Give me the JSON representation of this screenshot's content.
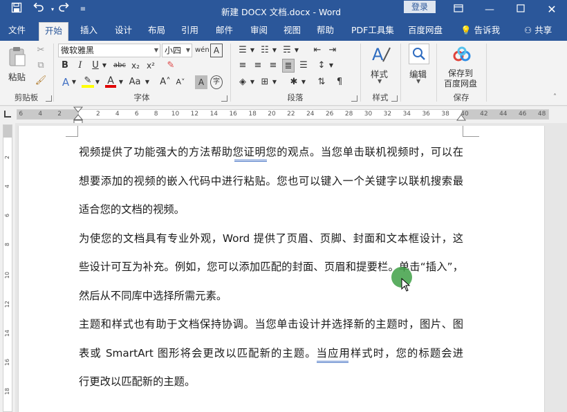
{
  "titlebar": {
    "title": "新建 DOCX 文档.docx  -  Word",
    "sign_in": "登录",
    "qat": {
      "save_icon": "save-icon",
      "undo_icon": "undo-icon",
      "redo_icon": "redo-icon",
      "customize_icon": "customize-qat-icon"
    }
  },
  "tabs": [
    {
      "label": "文件"
    },
    {
      "label": "开始"
    },
    {
      "label": "插入"
    },
    {
      "label": "设计"
    },
    {
      "label": "布局"
    },
    {
      "label": "引用"
    },
    {
      "label": "邮件"
    },
    {
      "label": "审阅"
    },
    {
      "label": "视图"
    },
    {
      "label": "帮助"
    },
    {
      "label": "PDF工具集"
    },
    {
      "label": "百度网盘"
    },
    {
      "label": "告诉我"
    },
    {
      "label": "共享"
    }
  ],
  "active_tab": "开始",
  "ribbon": {
    "clipboard": {
      "label": "剪贴板",
      "paste": "粘贴"
    },
    "font": {
      "label": "字体",
      "font_name": "微软雅黑",
      "font_size": "小四"
    },
    "paragraph": {
      "label": "段落"
    },
    "styles": {
      "label": "样式",
      "button": "样式"
    },
    "editing": {
      "button": "编辑"
    },
    "save": {
      "label": "保存",
      "button_line1": "保存到",
      "button_line2": "百度网盘"
    }
  },
  "ruler": {
    "ticks": [
      "6",
      "4",
      "2",
      "2",
      "4",
      "6",
      "8",
      "10",
      "12",
      "14",
      "16",
      "18",
      "20",
      "22",
      "24",
      "26",
      "28",
      "30",
      "32",
      "34",
      "36",
      "38",
      "40",
      "42",
      "44",
      "46",
      "48"
    ],
    "vticks": [
      "2",
      "4",
      "6",
      "8",
      "10",
      "12",
      "14",
      "16",
      "18"
    ]
  },
  "document": {
    "paragraphs": [
      {
        "lines": [
          "视频提供了功能强大的方法帮助您证明您的观点。当您单击联机视频时，可以在",
          "想要添加的视频的嵌入代码中进行粘贴。您也可以键入一个关键字以联机搜索最",
          "适合您的文档的视频。"
        ]
      },
      {
        "lines": [
          "为使您的文档具有专业外观，Word 提供了页眉、页脚、封面和文本框设计，这",
          "些设计可互为补充。例如，您可以添加匹配的封面、页眉和提要栏。单击“插入”，",
          "然后从不同库中选择所需元素。"
        ]
      },
      {
        "lines": [
          "主题和样式也有助于文档保持协调。当您单击设计并选择新的主题时，图片、图",
          "表或 SmartArt 图形将会更改以匹配新的主题。当应用样式时，您的标题会进",
          "行更改以匹配新的主题。"
        ]
      }
    ]
  }
}
